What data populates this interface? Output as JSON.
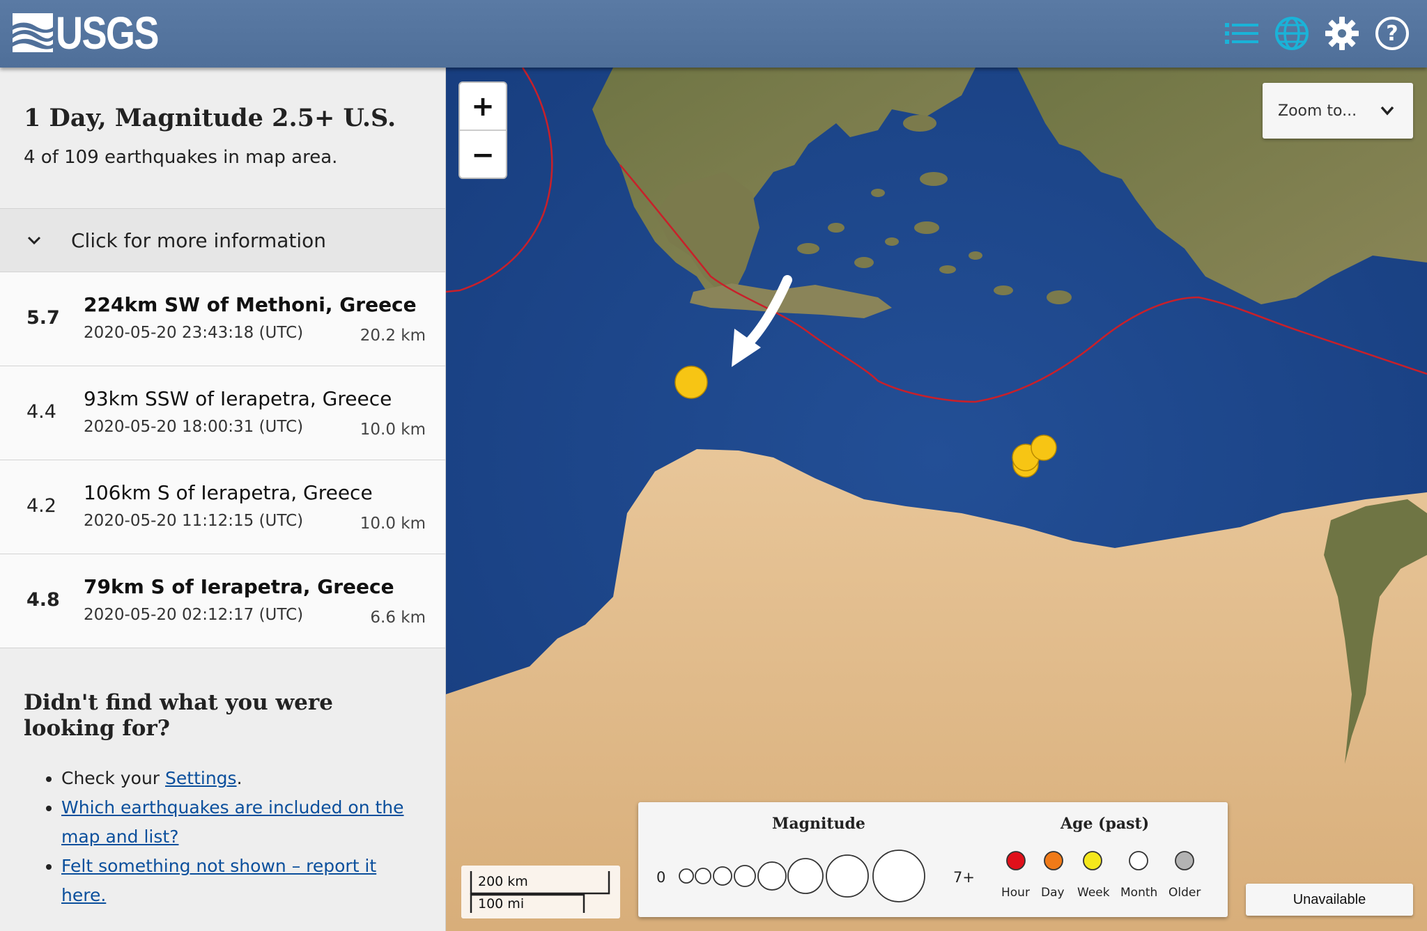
{
  "header": {
    "logo_text": "USGS",
    "icons": [
      "list-icon",
      "globe-icon",
      "gear-icon",
      "help-icon"
    ],
    "color": "#5a7aa4",
    "accent": "#1ab3d8"
  },
  "summary": {
    "title": "1 Day, Magnitude 2.5+ U.S.",
    "count_text": "4 of 109 earthquakes in map area."
  },
  "more_info": {
    "label": "Click for more information"
  },
  "earthquakes": [
    {
      "mag": "5.7",
      "place": "224km SW of Methoni, Greece",
      "time": "2020-05-20 23:43:18 (UTC)",
      "depth": "20.2 km",
      "bold": true
    },
    {
      "mag": "4.4",
      "place": "93km SSW of Ierapetra, Greece",
      "time": "2020-05-20 18:00:31 (UTC)",
      "depth": "10.0 km",
      "bold": false
    },
    {
      "mag": "4.2",
      "place": "106km S of Ierapetra, Greece",
      "time": "2020-05-20 11:12:15 (UTC)",
      "depth": "10.0 km",
      "bold": false
    },
    {
      "mag": "4.8",
      "place": "79km S of Ierapetra, Greece",
      "time": "2020-05-20 02:12:17 (UTC)",
      "depth": "6.6 km",
      "bold": true
    }
  ],
  "help": {
    "title": "Didn't find what you were looking for?",
    "check_prefix": "Check your ",
    "settings_link": "Settings",
    "check_suffix": ".",
    "link_included": "Which earthquakes are included on the map and list?",
    "link_felt": "Felt something not shown – report it here."
  },
  "map": {
    "zoom_in": "+",
    "zoom_out": "−",
    "zoom_to": "Zoom to...",
    "scale_km": "200 km",
    "scale_mi": "100 mi",
    "unavailable": "Unavailable",
    "markers_color": "#f7c514"
  },
  "legend": {
    "magnitude_title": "Magnitude",
    "min_label": "0",
    "max_label": "7+",
    "age_title": "Age (past)",
    "ages": [
      {
        "label": "Hour",
        "color": "#e0101a"
      },
      {
        "label": "Day",
        "color": "#f07a18"
      },
      {
        "label": "Week",
        "color": "#f5e81c"
      },
      {
        "label": "Month",
        "color": "#ffffff"
      },
      {
        "label": "Older",
        "color": "#b3b3b3"
      }
    ]
  }
}
